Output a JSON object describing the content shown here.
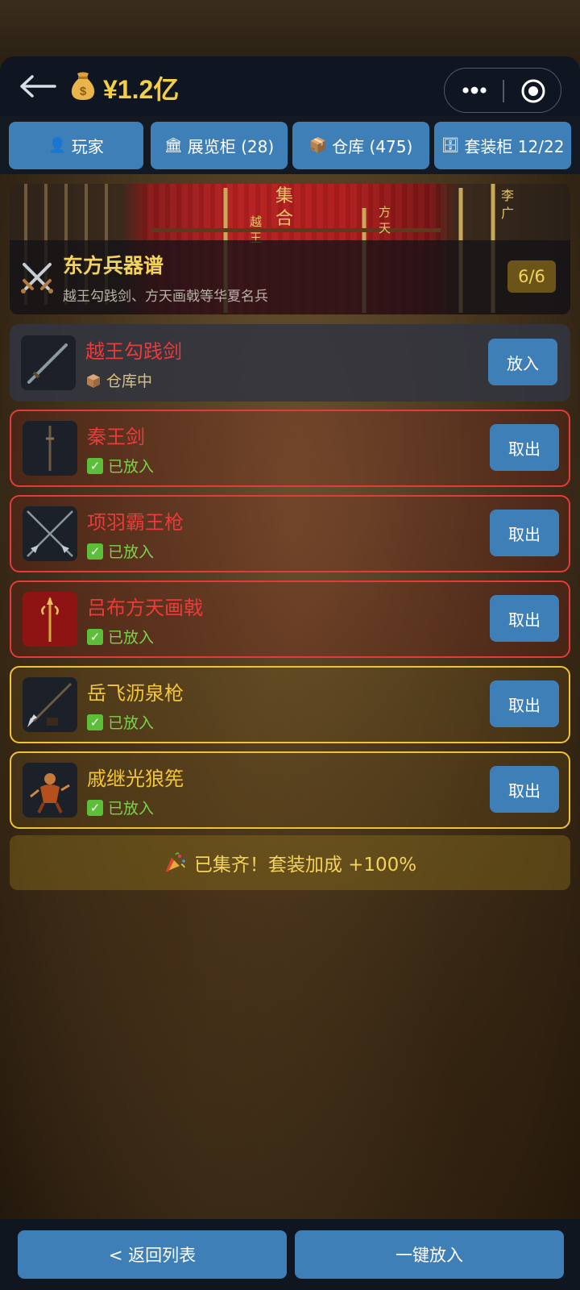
{
  "header": {
    "money": "¥1.2亿"
  },
  "tabs": [
    {
      "icon": "👤",
      "label": "玩家"
    },
    {
      "icon": "🏛",
      "label": "展览柜 (28)"
    },
    {
      "icon": "📦",
      "label": "仓库 (475)"
    },
    {
      "icon": "🗄",
      "label": "套装柜 12/22"
    }
  ],
  "set": {
    "title": "东方兵器谱",
    "description": "越王勾践剑、方天画戟等华夏名兵",
    "count": "6/6"
  },
  "items": [
    {
      "name": "越王勾践剑",
      "status": "仓库中",
      "button": "放入",
      "state": "stored"
    },
    {
      "name": "秦王剑",
      "status": "已放入",
      "button": "取出",
      "state": "red"
    },
    {
      "name": "项羽霸王枪",
      "status": "已放入",
      "button": "取出",
      "state": "red"
    },
    {
      "name": "吕布方天画戟",
      "status": "已放入",
      "button": "取出",
      "state": "red"
    },
    {
      "name": "岳飞沥泉枪",
      "status": "已放入",
      "button": "取出",
      "state": "gold"
    },
    {
      "name": "戚继光狼筅",
      "status": "已放入",
      "button": "取出",
      "state": "gold"
    }
  ],
  "bonus": {
    "text": "已集齐！套装加成 +100%"
  },
  "bottom": {
    "back_label": "< 返回列表",
    "put_all_label": "一键放入"
  },
  "colors": {
    "accent_gold": "#f3d35a",
    "button_blue": "#3f7fb7",
    "rarity_red": "#e53a3a",
    "rarity_gold": "#f1c233",
    "status_green": "#7fd04e"
  }
}
